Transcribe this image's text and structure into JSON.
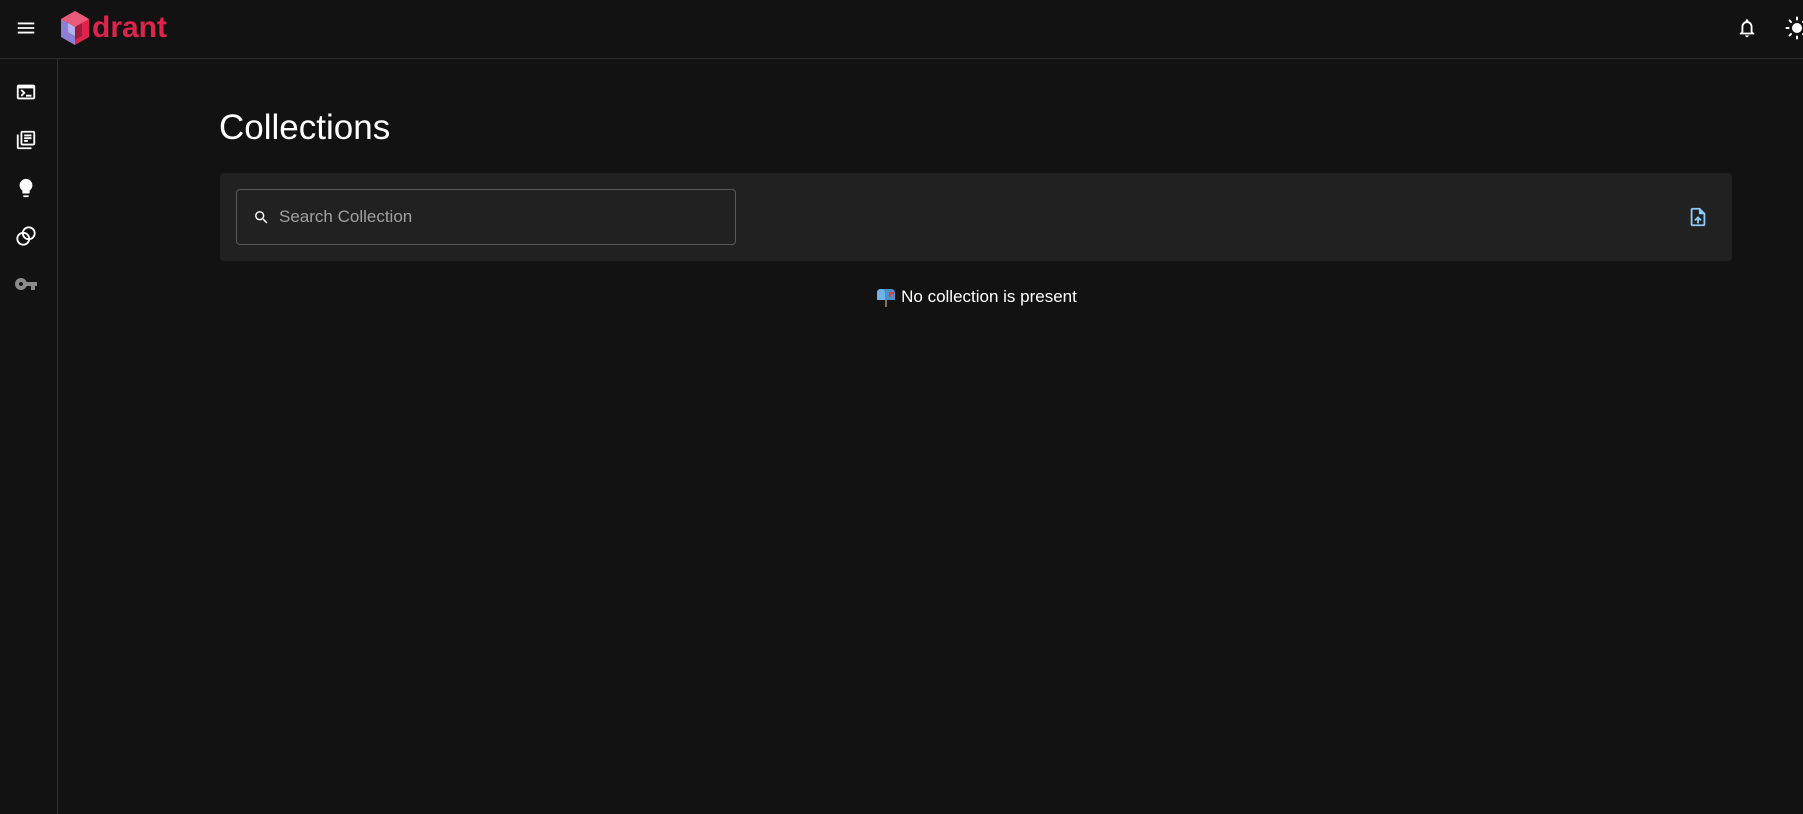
{
  "app": {
    "logo_text": "drant",
    "brand_color": "#dc244c",
    "icons": {
      "menu": "menu-icon",
      "notifications": "bell-icon",
      "theme": "sun-icon"
    }
  },
  "sidebar": {
    "items": [
      {
        "name": "console",
        "icon": "terminal-icon"
      },
      {
        "name": "collections",
        "icon": "library-icon"
      },
      {
        "name": "tutorial",
        "icon": "lightbulb-icon"
      },
      {
        "name": "datasets",
        "icon": "rings-icon"
      },
      {
        "name": "api-key",
        "icon": "key-icon"
      }
    ]
  },
  "main": {
    "title": "Collections",
    "search": {
      "placeholder": "Search Collection",
      "value": ""
    },
    "upload_icon": "upload-snapshot-icon",
    "upload_color": "#90caf9",
    "empty_message": "No collection is present"
  }
}
